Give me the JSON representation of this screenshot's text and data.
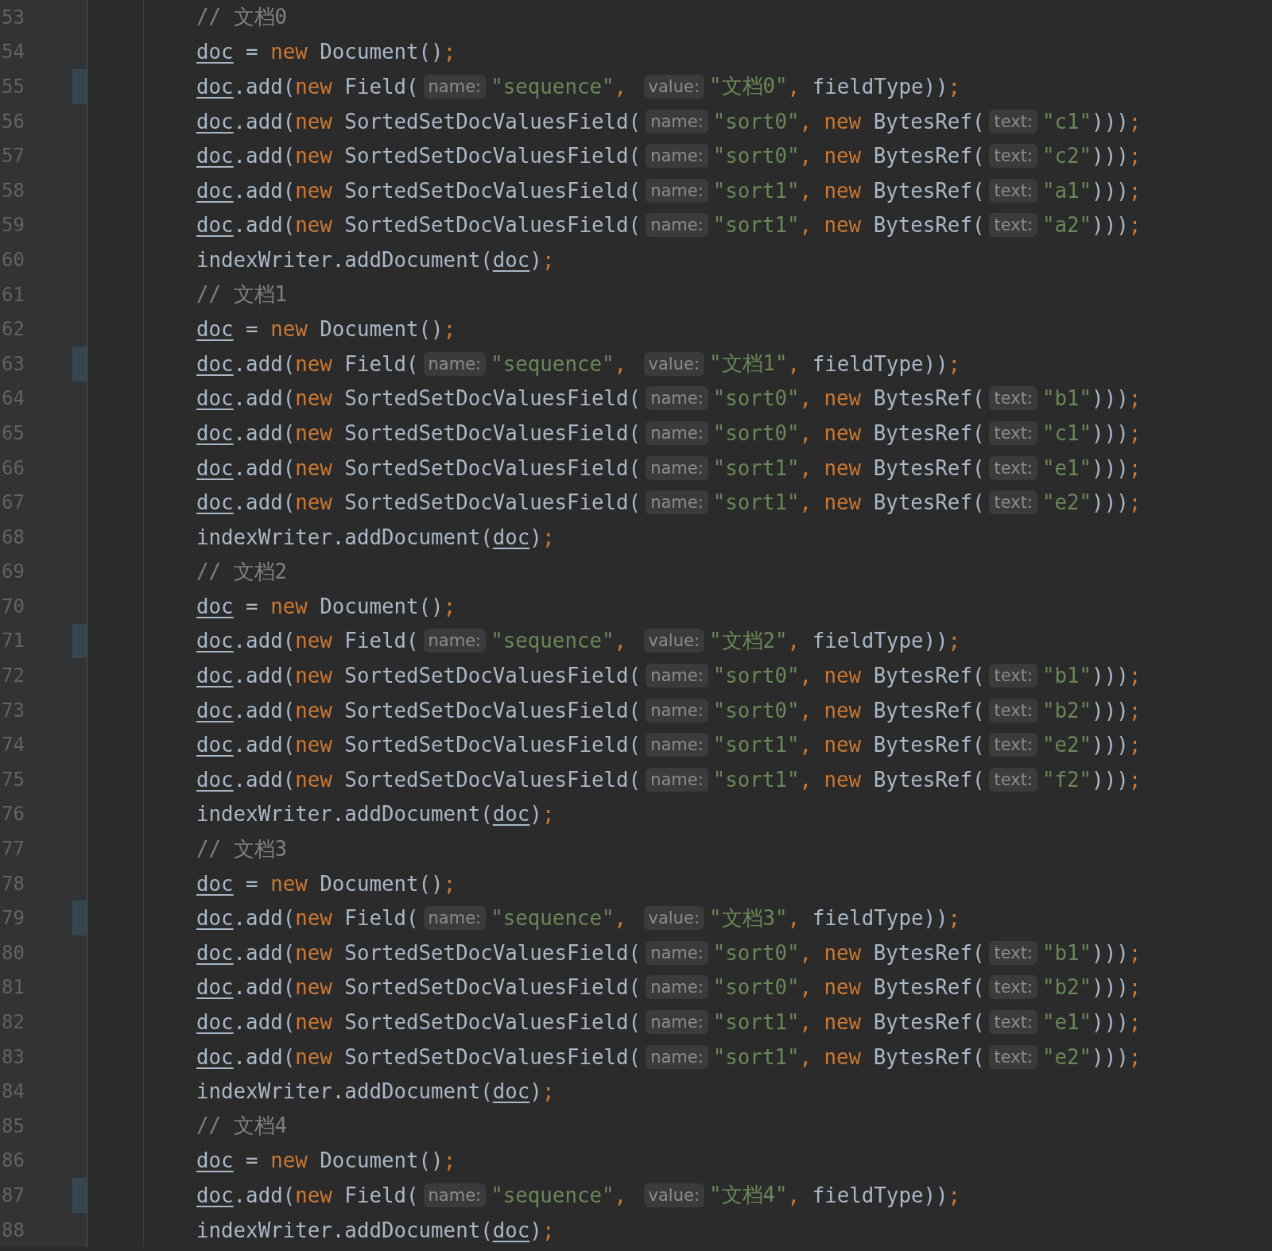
{
  "editor": {
    "lines": [
      {
        "number": "53",
        "changed": false,
        "tokens": [
          {
            "kind": "cmt",
            "text": "// 文档0"
          }
        ]
      },
      {
        "number": "54",
        "changed": false,
        "tokens": [
          {
            "kind": "var",
            "text": "doc"
          },
          {
            "kind": "text",
            "text": " = "
          },
          {
            "kind": "kw",
            "text": "new"
          },
          {
            "kind": "text",
            "text": " Document()"
          },
          {
            "kind": "punc",
            "text": ";"
          }
        ]
      },
      {
        "number": "55",
        "changed": true,
        "tokens": [
          {
            "kind": "var",
            "text": "doc"
          },
          {
            "kind": "text",
            "text": ".add("
          },
          {
            "kind": "kw",
            "text": "new"
          },
          {
            "kind": "text",
            "text": " Field("
          },
          {
            "kind": "hint",
            "text": "name:"
          },
          {
            "kind": "str",
            "text": "\"sequence\""
          },
          {
            "kind": "punc",
            "text": ", "
          },
          {
            "kind": "hint",
            "text": "value:"
          },
          {
            "kind": "str",
            "text": "\"文档0\""
          },
          {
            "kind": "punc",
            "text": ","
          },
          {
            "kind": "text",
            "text": " fieldType))"
          },
          {
            "kind": "punc",
            "text": ";"
          }
        ]
      },
      {
        "number": "56",
        "changed": false,
        "tokens": [
          {
            "kind": "var",
            "text": "doc"
          },
          {
            "kind": "text",
            "text": ".add("
          },
          {
            "kind": "kw",
            "text": "new"
          },
          {
            "kind": "text",
            "text": " SortedSetDocValuesField("
          },
          {
            "kind": "hint",
            "text": "name:"
          },
          {
            "kind": "str",
            "text": "\"sort0\""
          },
          {
            "kind": "punc",
            "text": ", "
          },
          {
            "kind": "kw",
            "text": "new"
          },
          {
            "kind": "text",
            "text": " BytesRef("
          },
          {
            "kind": "hint",
            "text": "text:"
          },
          {
            "kind": "str",
            "text": "\"c1\""
          },
          {
            "kind": "text",
            "text": ")))"
          },
          {
            "kind": "punc",
            "text": ";"
          }
        ]
      },
      {
        "number": "57",
        "changed": false,
        "tokens": [
          {
            "kind": "var",
            "text": "doc"
          },
          {
            "kind": "text",
            "text": ".add("
          },
          {
            "kind": "kw",
            "text": "new"
          },
          {
            "kind": "text",
            "text": " SortedSetDocValuesField("
          },
          {
            "kind": "hint",
            "text": "name:"
          },
          {
            "kind": "str",
            "text": "\"sort0\""
          },
          {
            "kind": "punc",
            "text": ", "
          },
          {
            "kind": "kw",
            "text": "new"
          },
          {
            "kind": "text",
            "text": " BytesRef("
          },
          {
            "kind": "hint",
            "text": "text:"
          },
          {
            "kind": "str",
            "text": "\"c2\""
          },
          {
            "kind": "text",
            "text": ")))"
          },
          {
            "kind": "punc",
            "text": ";"
          }
        ]
      },
      {
        "number": "58",
        "changed": false,
        "tokens": [
          {
            "kind": "var",
            "text": "doc"
          },
          {
            "kind": "text",
            "text": ".add("
          },
          {
            "kind": "kw",
            "text": "new"
          },
          {
            "kind": "text",
            "text": " SortedSetDocValuesField("
          },
          {
            "kind": "hint",
            "text": "name:"
          },
          {
            "kind": "str",
            "text": "\"sort1\""
          },
          {
            "kind": "punc",
            "text": ", "
          },
          {
            "kind": "kw",
            "text": "new"
          },
          {
            "kind": "text",
            "text": " BytesRef("
          },
          {
            "kind": "hint",
            "text": "text:"
          },
          {
            "kind": "str",
            "text": "\"a1\""
          },
          {
            "kind": "text",
            "text": ")))"
          },
          {
            "kind": "punc",
            "text": ";"
          }
        ]
      },
      {
        "number": "59",
        "changed": false,
        "tokens": [
          {
            "kind": "var",
            "text": "doc"
          },
          {
            "kind": "text",
            "text": ".add("
          },
          {
            "kind": "kw",
            "text": "new"
          },
          {
            "kind": "text",
            "text": " SortedSetDocValuesField("
          },
          {
            "kind": "hint",
            "text": "name:"
          },
          {
            "kind": "str",
            "text": "\"sort1\""
          },
          {
            "kind": "punc",
            "text": ", "
          },
          {
            "kind": "kw",
            "text": "new"
          },
          {
            "kind": "text",
            "text": " BytesRef("
          },
          {
            "kind": "hint",
            "text": "text:"
          },
          {
            "kind": "str",
            "text": "\"a2\""
          },
          {
            "kind": "text",
            "text": ")))"
          },
          {
            "kind": "punc",
            "text": ";"
          }
        ]
      },
      {
        "number": "60",
        "changed": false,
        "tokens": [
          {
            "kind": "text",
            "text": "indexWriter.addDocument("
          },
          {
            "kind": "var",
            "text": "doc"
          },
          {
            "kind": "text",
            "text": ")"
          },
          {
            "kind": "punc",
            "text": ";"
          }
        ]
      },
      {
        "number": "61",
        "changed": false,
        "tokens": [
          {
            "kind": "cmt",
            "text": "// 文档1"
          }
        ]
      },
      {
        "number": "62",
        "changed": false,
        "tokens": [
          {
            "kind": "var",
            "text": "doc"
          },
          {
            "kind": "text",
            "text": " = "
          },
          {
            "kind": "kw",
            "text": "new"
          },
          {
            "kind": "text",
            "text": " Document()"
          },
          {
            "kind": "punc",
            "text": ";"
          }
        ]
      },
      {
        "number": "63",
        "changed": true,
        "tokens": [
          {
            "kind": "var",
            "text": "doc"
          },
          {
            "kind": "text",
            "text": ".add("
          },
          {
            "kind": "kw",
            "text": "new"
          },
          {
            "kind": "text",
            "text": " Field("
          },
          {
            "kind": "hint",
            "text": "name:"
          },
          {
            "kind": "str",
            "text": "\"sequence\""
          },
          {
            "kind": "punc",
            "text": ", "
          },
          {
            "kind": "hint",
            "text": "value:"
          },
          {
            "kind": "str",
            "text": "\"文档1\""
          },
          {
            "kind": "punc",
            "text": ","
          },
          {
            "kind": "text",
            "text": " fieldType))"
          },
          {
            "kind": "punc",
            "text": ";"
          }
        ]
      },
      {
        "number": "64",
        "changed": false,
        "tokens": [
          {
            "kind": "var",
            "text": "doc"
          },
          {
            "kind": "text",
            "text": ".add("
          },
          {
            "kind": "kw",
            "text": "new"
          },
          {
            "kind": "text",
            "text": " SortedSetDocValuesField("
          },
          {
            "kind": "hint",
            "text": "name:"
          },
          {
            "kind": "str",
            "text": "\"sort0\""
          },
          {
            "kind": "punc",
            "text": ", "
          },
          {
            "kind": "kw",
            "text": "new"
          },
          {
            "kind": "text",
            "text": " BytesRef("
          },
          {
            "kind": "hint",
            "text": "text:"
          },
          {
            "kind": "str",
            "text": "\"b1\""
          },
          {
            "kind": "text",
            "text": ")))"
          },
          {
            "kind": "punc",
            "text": ";"
          }
        ]
      },
      {
        "number": "65",
        "changed": false,
        "tokens": [
          {
            "kind": "var",
            "text": "doc"
          },
          {
            "kind": "text",
            "text": ".add("
          },
          {
            "kind": "kw",
            "text": "new"
          },
          {
            "kind": "text",
            "text": " SortedSetDocValuesField("
          },
          {
            "kind": "hint",
            "text": "name:"
          },
          {
            "kind": "str",
            "text": "\"sort0\""
          },
          {
            "kind": "punc",
            "text": ", "
          },
          {
            "kind": "kw",
            "text": "new"
          },
          {
            "kind": "text",
            "text": " BytesRef("
          },
          {
            "kind": "hint",
            "text": "text:"
          },
          {
            "kind": "str",
            "text": "\"c1\""
          },
          {
            "kind": "text",
            "text": ")))"
          },
          {
            "kind": "punc",
            "text": ";"
          }
        ]
      },
      {
        "number": "66",
        "changed": false,
        "tokens": [
          {
            "kind": "var",
            "text": "doc"
          },
          {
            "kind": "text",
            "text": ".add("
          },
          {
            "kind": "kw",
            "text": "new"
          },
          {
            "kind": "text",
            "text": " SortedSetDocValuesField("
          },
          {
            "kind": "hint",
            "text": "name:"
          },
          {
            "kind": "str",
            "text": "\"sort1\""
          },
          {
            "kind": "punc",
            "text": ", "
          },
          {
            "kind": "kw",
            "text": "new"
          },
          {
            "kind": "text",
            "text": " BytesRef("
          },
          {
            "kind": "hint",
            "text": "text:"
          },
          {
            "kind": "str",
            "text": "\"e1\""
          },
          {
            "kind": "text",
            "text": ")))"
          },
          {
            "kind": "punc",
            "text": ";"
          }
        ]
      },
      {
        "number": "67",
        "changed": false,
        "tokens": [
          {
            "kind": "var",
            "text": "doc"
          },
          {
            "kind": "text",
            "text": ".add("
          },
          {
            "kind": "kw",
            "text": "new"
          },
          {
            "kind": "text",
            "text": " SortedSetDocValuesField("
          },
          {
            "kind": "hint",
            "text": "name:"
          },
          {
            "kind": "str",
            "text": "\"sort1\""
          },
          {
            "kind": "punc",
            "text": ", "
          },
          {
            "kind": "kw",
            "text": "new"
          },
          {
            "kind": "text",
            "text": " BytesRef("
          },
          {
            "kind": "hint",
            "text": "text:"
          },
          {
            "kind": "str",
            "text": "\"e2\""
          },
          {
            "kind": "text",
            "text": ")))"
          },
          {
            "kind": "punc",
            "text": ";"
          }
        ]
      },
      {
        "number": "68",
        "changed": false,
        "tokens": [
          {
            "kind": "text",
            "text": "indexWriter.addDocument("
          },
          {
            "kind": "var",
            "text": "doc"
          },
          {
            "kind": "text",
            "text": ")"
          },
          {
            "kind": "punc",
            "text": ";"
          }
        ]
      },
      {
        "number": "69",
        "changed": false,
        "tokens": [
          {
            "kind": "cmt",
            "text": "// 文档2"
          }
        ]
      },
      {
        "number": "70",
        "changed": false,
        "tokens": [
          {
            "kind": "var",
            "text": "doc"
          },
          {
            "kind": "text",
            "text": " = "
          },
          {
            "kind": "kw",
            "text": "new"
          },
          {
            "kind": "text",
            "text": " Document()"
          },
          {
            "kind": "punc",
            "text": ";"
          }
        ]
      },
      {
        "number": "71",
        "changed": true,
        "tokens": [
          {
            "kind": "var",
            "text": "doc"
          },
          {
            "kind": "text",
            "text": ".add("
          },
          {
            "kind": "kw",
            "text": "new"
          },
          {
            "kind": "text",
            "text": " Field("
          },
          {
            "kind": "hint",
            "text": "name:"
          },
          {
            "kind": "str",
            "text": "\"sequence\""
          },
          {
            "kind": "punc",
            "text": ", "
          },
          {
            "kind": "hint",
            "text": "value:"
          },
          {
            "kind": "str",
            "text": "\"文档2\""
          },
          {
            "kind": "punc",
            "text": ","
          },
          {
            "kind": "text",
            "text": " fieldType))"
          },
          {
            "kind": "punc",
            "text": ";"
          }
        ]
      },
      {
        "number": "72",
        "changed": false,
        "tokens": [
          {
            "kind": "var",
            "text": "doc"
          },
          {
            "kind": "text",
            "text": ".add("
          },
          {
            "kind": "kw",
            "text": "new"
          },
          {
            "kind": "text",
            "text": " SortedSetDocValuesField("
          },
          {
            "kind": "hint",
            "text": "name:"
          },
          {
            "kind": "str",
            "text": "\"sort0\""
          },
          {
            "kind": "punc",
            "text": ", "
          },
          {
            "kind": "kw",
            "text": "new"
          },
          {
            "kind": "text",
            "text": " BytesRef("
          },
          {
            "kind": "hint",
            "text": "text:"
          },
          {
            "kind": "str",
            "text": "\"b1\""
          },
          {
            "kind": "text",
            "text": ")))"
          },
          {
            "kind": "punc",
            "text": ";"
          }
        ]
      },
      {
        "number": "73",
        "changed": false,
        "tokens": [
          {
            "kind": "var",
            "text": "doc"
          },
          {
            "kind": "text",
            "text": ".add("
          },
          {
            "kind": "kw",
            "text": "new"
          },
          {
            "kind": "text",
            "text": " SortedSetDocValuesField("
          },
          {
            "kind": "hint",
            "text": "name:"
          },
          {
            "kind": "str",
            "text": "\"sort0\""
          },
          {
            "kind": "punc",
            "text": ", "
          },
          {
            "kind": "kw",
            "text": "new"
          },
          {
            "kind": "text",
            "text": " BytesRef("
          },
          {
            "kind": "hint",
            "text": "text:"
          },
          {
            "kind": "str",
            "text": "\"b2\""
          },
          {
            "kind": "text",
            "text": ")))"
          },
          {
            "kind": "punc",
            "text": ";"
          }
        ]
      },
      {
        "number": "74",
        "changed": false,
        "tokens": [
          {
            "kind": "var",
            "text": "doc"
          },
          {
            "kind": "text",
            "text": ".add("
          },
          {
            "kind": "kw",
            "text": "new"
          },
          {
            "kind": "text",
            "text": " SortedSetDocValuesField("
          },
          {
            "kind": "hint",
            "text": "name:"
          },
          {
            "kind": "str",
            "text": "\"sort1\""
          },
          {
            "kind": "punc",
            "text": ", "
          },
          {
            "kind": "kw",
            "text": "new"
          },
          {
            "kind": "text",
            "text": " BytesRef("
          },
          {
            "kind": "hint",
            "text": "text:"
          },
          {
            "kind": "str",
            "text": "\"e2\""
          },
          {
            "kind": "text",
            "text": ")))"
          },
          {
            "kind": "punc",
            "text": ";"
          }
        ]
      },
      {
        "number": "75",
        "changed": false,
        "tokens": [
          {
            "kind": "var",
            "text": "doc"
          },
          {
            "kind": "text",
            "text": ".add("
          },
          {
            "kind": "kw",
            "text": "new"
          },
          {
            "kind": "text",
            "text": " SortedSetDocValuesField("
          },
          {
            "kind": "hint",
            "text": "name:"
          },
          {
            "kind": "str",
            "text": "\"sort1\""
          },
          {
            "kind": "punc",
            "text": ", "
          },
          {
            "kind": "kw",
            "text": "new"
          },
          {
            "kind": "text",
            "text": " BytesRef("
          },
          {
            "kind": "hint",
            "text": "text:"
          },
          {
            "kind": "str",
            "text": "\"f2\""
          },
          {
            "kind": "text",
            "text": ")))"
          },
          {
            "kind": "punc",
            "text": ";"
          }
        ]
      },
      {
        "number": "76",
        "changed": false,
        "tokens": [
          {
            "kind": "text",
            "text": "indexWriter.addDocument("
          },
          {
            "kind": "var",
            "text": "doc"
          },
          {
            "kind": "text",
            "text": ")"
          },
          {
            "kind": "punc",
            "text": ";"
          }
        ]
      },
      {
        "number": "77",
        "changed": false,
        "tokens": [
          {
            "kind": "cmt",
            "text": "// 文档3"
          }
        ]
      },
      {
        "number": "78",
        "changed": false,
        "tokens": [
          {
            "kind": "var",
            "text": "doc"
          },
          {
            "kind": "text",
            "text": " = "
          },
          {
            "kind": "kw",
            "text": "new"
          },
          {
            "kind": "text",
            "text": " Document()"
          },
          {
            "kind": "punc",
            "text": ";"
          }
        ]
      },
      {
        "number": "79",
        "changed": true,
        "tokens": [
          {
            "kind": "var",
            "text": "doc"
          },
          {
            "kind": "text",
            "text": ".add("
          },
          {
            "kind": "kw",
            "text": "new"
          },
          {
            "kind": "text",
            "text": " Field("
          },
          {
            "kind": "hint",
            "text": "name:"
          },
          {
            "kind": "str",
            "text": "\"sequence\""
          },
          {
            "kind": "punc",
            "text": ", "
          },
          {
            "kind": "hint",
            "text": "value:"
          },
          {
            "kind": "str",
            "text": "\"文档3\""
          },
          {
            "kind": "punc",
            "text": ","
          },
          {
            "kind": "text",
            "text": " fieldType))"
          },
          {
            "kind": "punc",
            "text": ";"
          }
        ]
      },
      {
        "number": "80",
        "changed": false,
        "tokens": [
          {
            "kind": "var",
            "text": "doc"
          },
          {
            "kind": "text",
            "text": ".add("
          },
          {
            "kind": "kw",
            "text": "new"
          },
          {
            "kind": "text",
            "text": " SortedSetDocValuesField("
          },
          {
            "kind": "hint",
            "text": "name:"
          },
          {
            "kind": "str",
            "text": "\"sort0\""
          },
          {
            "kind": "punc",
            "text": ", "
          },
          {
            "kind": "kw",
            "text": "new"
          },
          {
            "kind": "text",
            "text": " BytesRef("
          },
          {
            "kind": "hint",
            "text": "text:"
          },
          {
            "kind": "str",
            "text": "\"b1\""
          },
          {
            "kind": "text",
            "text": ")))"
          },
          {
            "kind": "punc",
            "text": ";"
          }
        ]
      },
      {
        "number": "81",
        "changed": false,
        "tokens": [
          {
            "kind": "var",
            "text": "doc"
          },
          {
            "kind": "text",
            "text": ".add("
          },
          {
            "kind": "kw",
            "text": "new"
          },
          {
            "kind": "text",
            "text": " SortedSetDocValuesField("
          },
          {
            "kind": "hint",
            "text": "name:"
          },
          {
            "kind": "str",
            "text": "\"sort0\""
          },
          {
            "kind": "punc",
            "text": ", "
          },
          {
            "kind": "kw",
            "text": "new"
          },
          {
            "kind": "text",
            "text": " BytesRef("
          },
          {
            "kind": "hint",
            "text": "text:"
          },
          {
            "kind": "str",
            "text": "\"b2\""
          },
          {
            "kind": "text",
            "text": ")))"
          },
          {
            "kind": "punc",
            "text": ";"
          }
        ]
      },
      {
        "number": "82",
        "changed": false,
        "tokens": [
          {
            "kind": "var",
            "text": "doc"
          },
          {
            "kind": "text",
            "text": ".add("
          },
          {
            "kind": "kw",
            "text": "new"
          },
          {
            "kind": "text",
            "text": " SortedSetDocValuesField("
          },
          {
            "kind": "hint",
            "text": "name:"
          },
          {
            "kind": "str",
            "text": "\"sort1\""
          },
          {
            "kind": "punc",
            "text": ", "
          },
          {
            "kind": "kw",
            "text": "new"
          },
          {
            "kind": "text",
            "text": " BytesRef("
          },
          {
            "kind": "hint",
            "text": "text:"
          },
          {
            "kind": "str",
            "text": "\"e1\""
          },
          {
            "kind": "text",
            "text": ")))"
          },
          {
            "kind": "punc",
            "text": ";"
          }
        ]
      },
      {
        "number": "83",
        "changed": false,
        "tokens": [
          {
            "kind": "var",
            "text": "doc"
          },
          {
            "kind": "text",
            "text": ".add("
          },
          {
            "kind": "kw",
            "text": "new"
          },
          {
            "kind": "text",
            "text": " SortedSetDocValuesField("
          },
          {
            "kind": "hint",
            "text": "name:"
          },
          {
            "kind": "str",
            "text": "\"sort1\""
          },
          {
            "kind": "punc",
            "text": ", "
          },
          {
            "kind": "kw",
            "text": "new"
          },
          {
            "kind": "text",
            "text": " BytesRef("
          },
          {
            "kind": "hint",
            "text": "text:"
          },
          {
            "kind": "str",
            "text": "\"e2\""
          },
          {
            "kind": "text",
            "text": ")))"
          },
          {
            "kind": "punc",
            "text": ";"
          }
        ]
      },
      {
        "number": "84",
        "changed": false,
        "tokens": [
          {
            "kind": "text",
            "text": "indexWriter.addDocument("
          },
          {
            "kind": "var",
            "text": "doc"
          },
          {
            "kind": "text",
            "text": ")"
          },
          {
            "kind": "punc",
            "text": ";"
          }
        ]
      },
      {
        "number": "85",
        "changed": false,
        "tokens": [
          {
            "kind": "cmt",
            "text": "// 文档4"
          }
        ]
      },
      {
        "number": "86",
        "changed": false,
        "tokens": [
          {
            "kind": "var",
            "text": "doc"
          },
          {
            "kind": "text",
            "text": " = "
          },
          {
            "kind": "kw",
            "text": "new"
          },
          {
            "kind": "text",
            "text": " Document()"
          },
          {
            "kind": "punc",
            "text": ";"
          }
        ]
      },
      {
        "number": "87",
        "changed": true,
        "tokens": [
          {
            "kind": "var",
            "text": "doc"
          },
          {
            "kind": "text",
            "text": ".add("
          },
          {
            "kind": "kw",
            "text": "new"
          },
          {
            "kind": "text",
            "text": " Field("
          },
          {
            "kind": "hint",
            "text": "name:"
          },
          {
            "kind": "str",
            "text": "\"sequence\""
          },
          {
            "kind": "punc",
            "text": ", "
          },
          {
            "kind": "hint",
            "text": "value:"
          },
          {
            "kind": "str",
            "text": "\"文档4\""
          },
          {
            "kind": "punc",
            "text": ","
          },
          {
            "kind": "text",
            "text": " fieldType))"
          },
          {
            "kind": "punc",
            "text": ";"
          }
        ]
      },
      {
        "number": "88",
        "changed": false,
        "tokens": [
          {
            "kind": "text",
            "text": "indexWriter.addDocument("
          },
          {
            "kind": "var",
            "text": "doc"
          },
          {
            "kind": "text",
            "text": ")"
          },
          {
            "kind": "punc",
            "text": ";"
          }
        ]
      }
    ]
  }
}
